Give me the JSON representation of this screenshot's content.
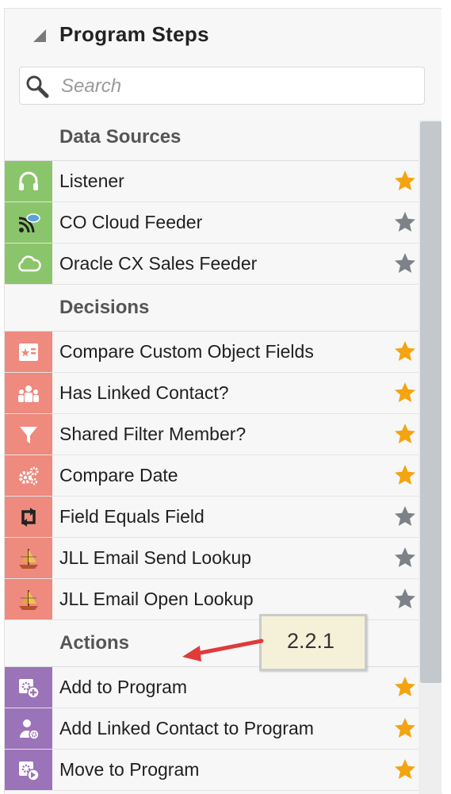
{
  "panel": {
    "title": "Program Steps"
  },
  "search": {
    "placeholder": "Search"
  },
  "sections": [
    {
      "title": "Data Sources",
      "items": [
        {
          "label": "Listener",
          "icon": "headphones-icon",
          "color": "green",
          "favorite": true
        },
        {
          "label": "CO Cloud Feeder",
          "icon": "cloud-feed-icon",
          "color": "green",
          "favorite": false
        },
        {
          "label": "Oracle CX Sales Feeder",
          "icon": "cloud-icon",
          "color": "green",
          "favorite": false
        }
      ]
    },
    {
      "title": "Decisions",
      "items": [
        {
          "label": "Compare Custom Object Fields",
          "icon": "custom-object-icon",
          "color": "red",
          "favorite": true
        },
        {
          "label": "Has Linked Contact?",
          "icon": "people-icon",
          "color": "red",
          "favorite": true
        },
        {
          "label": "Shared Filter Member?",
          "icon": "filter-icon",
          "color": "red",
          "favorite": true
        },
        {
          "label": "Compare Date",
          "icon": "gears-icon",
          "color": "red",
          "favorite": true
        },
        {
          "label": "Field Equals Field",
          "icon": "swap-arrows-icon",
          "color": "red",
          "favorite": false
        },
        {
          "label": "JLL Email Send Lookup",
          "icon": "ship-icon",
          "color": "red",
          "favorite": false
        },
        {
          "label": "JLL Email Open Lookup",
          "icon": "ship-icon",
          "color": "red",
          "favorite": false
        }
      ]
    },
    {
      "title": "Actions",
      "items": [
        {
          "label": "Add to Program",
          "icon": "add-to-program-icon",
          "color": "purple",
          "favorite": true
        },
        {
          "label": "Add Linked Contact to Program",
          "icon": "linked-contact-icon",
          "color": "purple",
          "favorite": true
        },
        {
          "label": "Move to Program",
          "icon": "move-to-program-icon",
          "color": "purple",
          "favorite": true
        }
      ]
    }
  ],
  "callout": {
    "text": "2.2.1"
  },
  "colors": {
    "favorite_star": "#f4a410",
    "unfavorite_star": "#7c8288",
    "green": "#8bc56b",
    "red": "#ee8a7e",
    "purple": "#9b73b8",
    "arrow": "#e03a3a"
  }
}
